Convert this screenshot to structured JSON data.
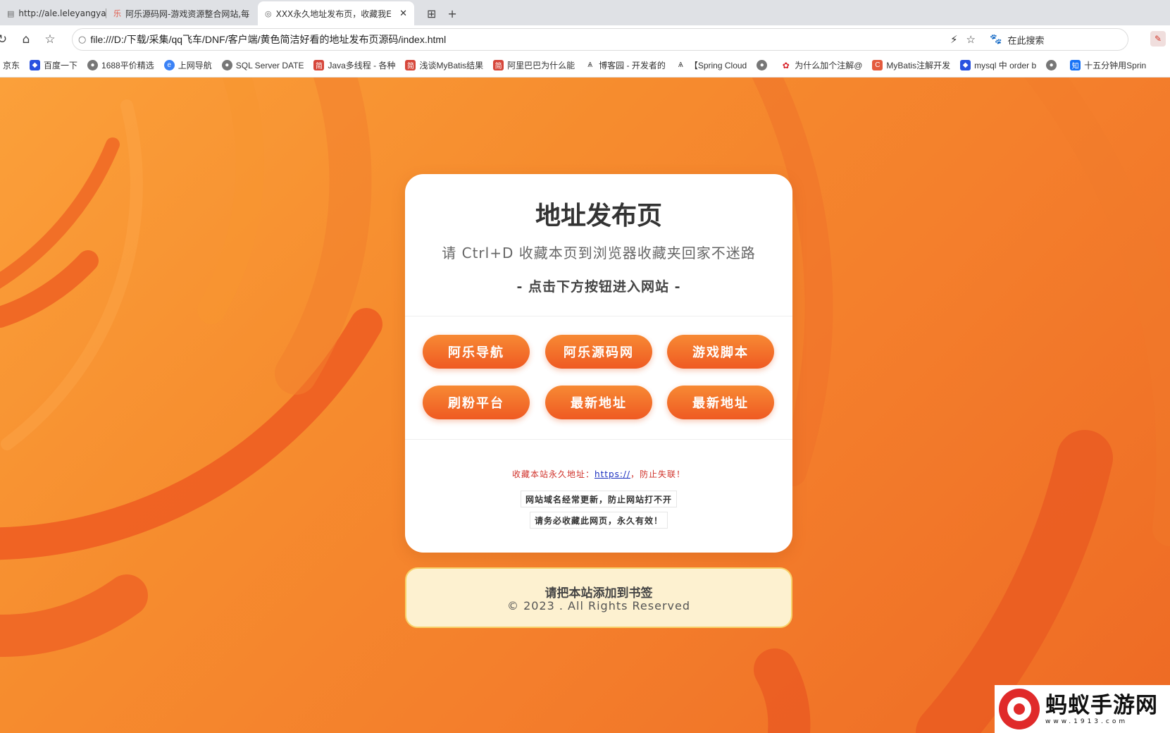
{
  "browser": {
    "tabs": [
      {
        "title": "http://ale.leleyangya"
      },
      {
        "title": "阿乐源码网-游戏资源整合网站,每"
      },
      {
        "title": "XXX永久地址发布页，收藏我E"
      }
    ],
    "url": "file:///D:/下载/采集/qq飞车/DNF/客户端/黄色简洁好看的地址发布页源码/index.html",
    "search_engine_label": "在此搜索",
    "bookmarks": [
      "京东",
      "百度一下",
      "1688平价精选",
      "上网导航",
      "SQL Server DATE",
      "Java多线程 - 各种",
      "浅谈MyBatis结果",
      "阿里巴巴为什么能",
      "博客园 - 开发者的",
      "【Spring Cloud",
      "为什么加个注解@",
      "MyBatis注解开发",
      "mysql 中 order b",
      "十五分钟用Sprin"
    ]
  },
  "card": {
    "title": "地址发布页",
    "subtitle": "请 Ctrl+D 收藏本页到浏览器收藏夹回家不迷路",
    "hint": "- 点击下方按钮进入网站 -",
    "buttons": [
      "阿乐导航",
      "阿乐源码网",
      "游戏脚本",
      "刷粉平台",
      "最新地址",
      "最新地址"
    ],
    "notice_prefix": "收藏本站永久地址：",
    "notice_link": "https://",
    "notice_suffix": "，防止失联！",
    "pill1": "网站域名经常更新，防止网站打不开",
    "pill2": "请务必收藏此网页，永久有效！"
  },
  "footer": {
    "line1": "请把本站添加到书签",
    "line2": "© 2023 . All Rights Reserved"
  },
  "watermark": {
    "name": "蚂蚁手游网",
    "url": "www.1913.com"
  },
  "colors": {
    "page_bg": "#f47a2a",
    "button": "#ef5a22",
    "footer_bg": "#fdf1d0",
    "notice_text": "#d0322a",
    "link": "#1a2fbf"
  }
}
